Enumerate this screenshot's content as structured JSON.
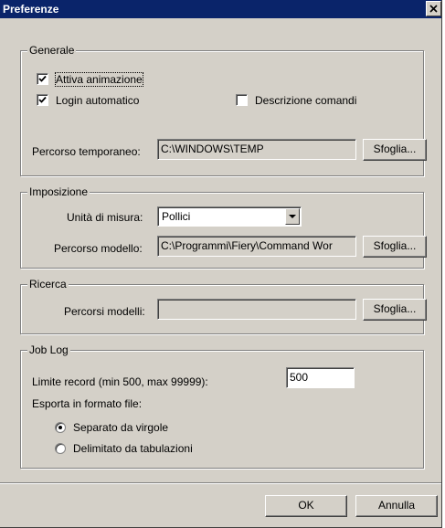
{
  "window": {
    "title": "Preferenze",
    "close_icon": "close-icon"
  },
  "generale": {
    "legend": "Generale",
    "attiva_animazione": {
      "label": "Attiva animazione",
      "checked": true
    },
    "login_automatico": {
      "label": "Login automatico",
      "checked": true
    },
    "descrizione_comandi": {
      "label": "Descrizione comandi",
      "checked": false
    },
    "percorso_label": "Percorso temporaneo:",
    "percorso_value": "C:\\WINDOWS\\TEMP",
    "sfoglia": "Sfoglia..."
  },
  "imposizione": {
    "legend": "Imposizione",
    "unita_label": "Unità di misura:",
    "unita_value": "Pollici",
    "modello_label": "Percorso modello:",
    "modello_value": "C:\\Programmi\\Fiery\\Command Wor",
    "sfoglia": "Sfoglia..."
  },
  "ricerca": {
    "legend": "Ricerca",
    "percorsi_label": "Percorsi modelli:",
    "percorsi_value": "",
    "sfoglia": "Sfoglia..."
  },
  "joblog": {
    "legend": "Job Log",
    "limite_label": "Limite record (min 500, max 99999):",
    "limite_value": "500",
    "esporta_label": "Esporta in formato file:",
    "separato": {
      "label": "Separato da virgole",
      "selected": true
    },
    "delimitato": {
      "label": "Delimitato da tabulazioni",
      "selected": false
    }
  },
  "footer": {
    "ok": "OK",
    "annulla": "Annulla"
  }
}
